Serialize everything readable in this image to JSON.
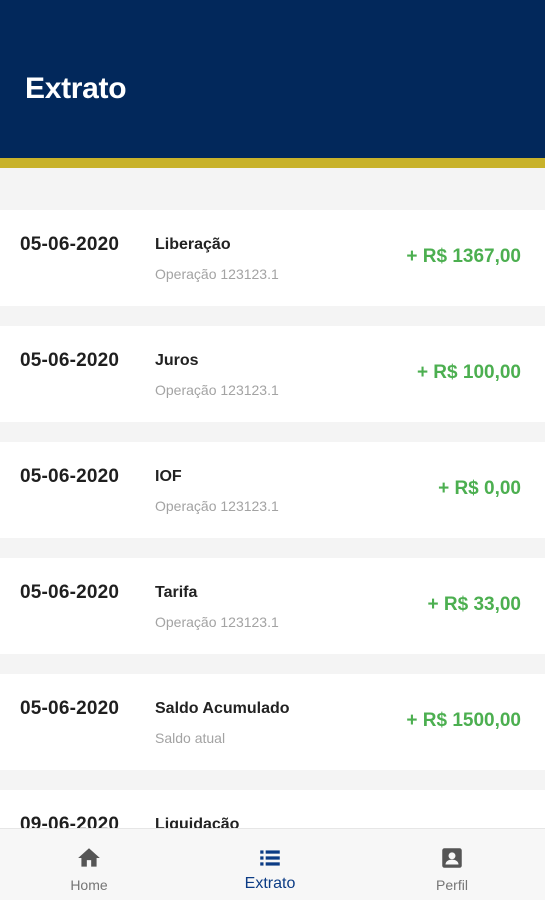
{
  "header": {
    "title": "Extrato"
  },
  "colors": {
    "header_bg": "#02285b",
    "stripe": "#c8b22a",
    "amount": "#4caf50",
    "active_nav": "#0c3c85"
  },
  "transactions": [
    {
      "date": "05-06-2020",
      "title": "Liberação",
      "subtitle": "Operação 123123.1",
      "amount": "+ R$ 1367,00"
    },
    {
      "date": "05-06-2020",
      "title": "Juros",
      "subtitle": "Operação 123123.1",
      "amount": "+ R$ 100,00"
    },
    {
      "date": "05-06-2020",
      "title": "IOF",
      "subtitle": "Operação 123123.1",
      "amount": "+ R$ 0,00"
    },
    {
      "date": "05-06-2020",
      "title": "Tarifa",
      "subtitle": "Operação 123123.1",
      "amount": "+ R$ 33,00"
    },
    {
      "date": "05-06-2020",
      "title": "Saldo Acumulado",
      "subtitle": "Saldo atual",
      "amount": "+ R$ 1500,00"
    },
    {
      "date": "09-06-2020",
      "title": "Liquidação",
      "subtitle": "",
      "amount": ""
    }
  ],
  "nav": {
    "home": {
      "label": "Home",
      "icon": "home-icon"
    },
    "extrato": {
      "label": "Extrato",
      "icon": "list-icon"
    },
    "perfil": {
      "label": "Perfil",
      "icon": "profile-icon"
    }
  }
}
